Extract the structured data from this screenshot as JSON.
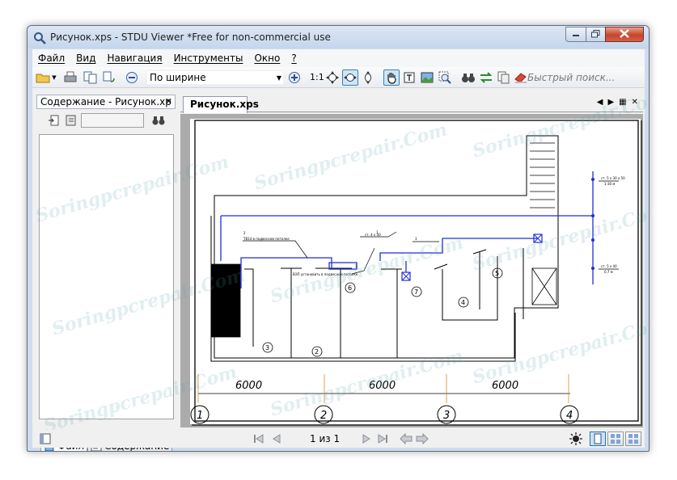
{
  "window": {
    "title": "Рисунок.xps - STDU Viewer *Free for non-commercial use"
  },
  "menu": {
    "items": [
      "Файл",
      "Вид",
      "Навигация",
      "Инструменты",
      "Окно",
      "?"
    ]
  },
  "toolbar": {
    "zoom_value": "По ширине",
    "actual_size_label": "1:1",
    "search_placeholder": "Быстрый поиск..."
  },
  "sidebar": {
    "header_title": "Содержание - Рисунок.xp",
    "tabs": [
      "Файл",
      "Содержание"
    ]
  },
  "document": {
    "tab_label": "Рисунок.xps"
  },
  "drawing": {
    "dimensions": [
      "6000",
      "6000",
      "6000"
    ],
    "axes": [
      "1",
      "2",
      "3",
      "4"
    ],
    "rooms": [
      "3",
      "2",
      "6",
      "7",
      "4",
      "5"
    ],
    "annotations": [
      "ТВ14 в подвесном потолке",
      "ст. 4 х 40",
      "ВЭП установить в подвесном потолке",
      "ст. 5 х 30 х 50",
      "1-30 м",
      "ст. 5 х 40",
      "0,7 м"
    ],
    "leader_numbers": [
      "2",
      "1",
      "3",
      "3"
    ]
  },
  "status": {
    "page_indicator": "1 из 1"
  },
  "watermark": "Soringpcrepair.Com",
  "colors": {
    "accent_blue": "#1f2fd6",
    "frame": "#000000",
    "grid_axis": "#d48a2a"
  }
}
